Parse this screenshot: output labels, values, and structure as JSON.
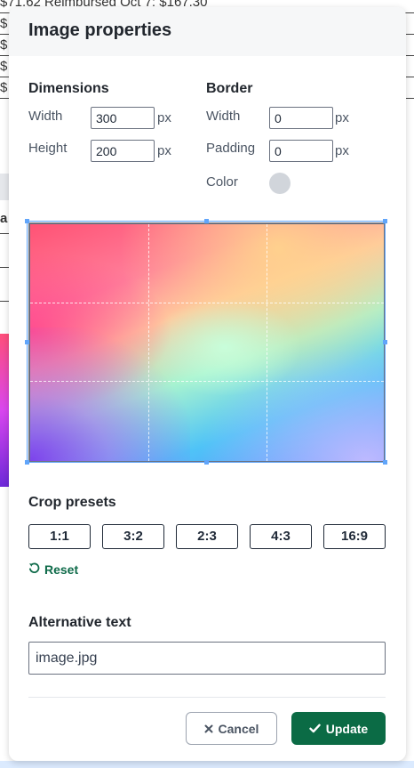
{
  "background": {
    "rows": [
      "$71.62 Reimbursed Oct 7: $167.30",
      "$",
      "$",
      "$",
      "$"
    ],
    "side_letter": "a"
  },
  "dialog": {
    "title": "Image properties",
    "dimensions": {
      "heading": "Dimensions",
      "width_label": "Width",
      "width_value": "300",
      "height_label": "Height",
      "height_value": "200",
      "unit": "px"
    },
    "border": {
      "heading": "Border",
      "width_label": "Width",
      "width_value": "0",
      "padding_label": "Padding",
      "padding_value": "0",
      "unit": "px",
      "color_label": "Color",
      "color_value": "#d1d5db"
    },
    "crop": {
      "heading": "Crop presets",
      "presets": [
        "1:1",
        "3:2",
        "2:3",
        "4:3",
        "16:9"
      ],
      "reset_label": "Reset"
    },
    "alt_text": {
      "heading": "Alternative text",
      "value": "image.jpg"
    },
    "footer": {
      "cancel_label": "Cancel",
      "update_label": "Update"
    }
  },
  "colors": {
    "accent": "#0b6b45",
    "crop_outline": "#60a5fa"
  }
}
